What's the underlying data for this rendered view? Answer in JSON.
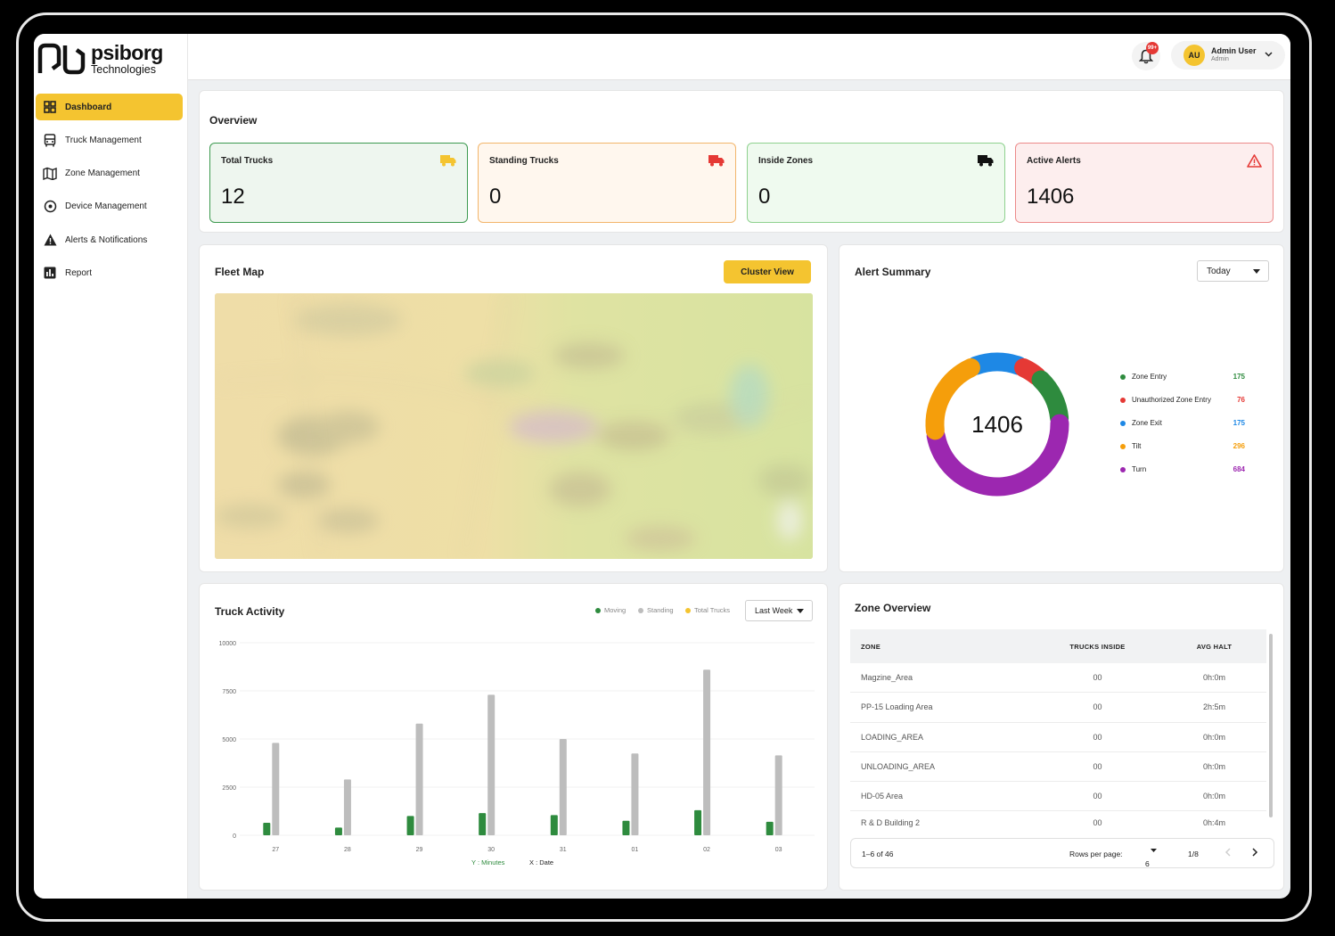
{
  "brand": {
    "name": "psiborg",
    "tagline": "Technologies"
  },
  "sidebar": {
    "items": [
      {
        "label": "Dashboard",
        "icon": "grid-icon",
        "active": true
      },
      {
        "label": "Truck Management",
        "icon": "truck-front-icon"
      },
      {
        "label": "Zone Management",
        "icon": "map-icon"
      },
      {
        "label": "Device Management",
        "icon": "target-icon"
      },
      {
        "label": "Alerts & Notifications",
        "icon": "warning-icon"
      },
      {
        "label": "Report",
        "icon": "bar-chart-icon"
      }
    ]
  },
  "topbar": {
    "notifications_badge": "99+",
    "user": {
      "initials": "AU",
      "name": "Admin User",
      "role": "Admin"
    }
  },
  "overview": {
    "title": "Overview",
    "stats": [
      {
        "label": "Total Trucks",
        "value": "12",
        "color": "#3d9a50",
        "bg": "#eef6ef",
        "icon_color": "#f4c430"
      },
      {
        "label": "Standing Trucks",
        "value": "0",
        "color": "#f2b56b",
        "bg": "#fff7ee",
        "icon_color": "#e53935"
      },
      {
        "label": "Inside Zones",
        "value": "0",
        "color": "#8fd18f",
        "bg": "#effaef",
        "icon_color": "#111111"
      },
      {
        "label": "Active Alerts",
        "value": "1406",
        "color": "#ec8a8a",
        "bg": "#fdeeee",
        "icon_color": "#e53935"
      }
    ]
  },
  "fleet_map": {
    "title": "Fleet Map",
    "button": "Cluster View"
  },
  "alert_summary": {
    "title": "Alert Summary",
    "filter": "Today",
    "total": "1406",
    "items": [
      {
        "label": "Zone Entry",
        "value": 175,
        "color": "#2e8b3e"
      },
      {
        "label": "Unauthorized Zone Entry",
        "value": 76,
        "color": "#e53935"
      },
      {
        "label": "Zone Exit",
        "value": 175,
        "color": "#1e88e5"
      },
      {
        "label": "Tilt",
        "value": 296,
        "color": "#f59e0b"
      },
      {
        "label": "Turn",
        "value": 684,
        "color": "#9c27b0"
      }
    ]
  },
  "truck_activity": {
    "title": "Truck Activity",
    "filter": "Last Week",
    "legend": [
      {
        "label": "Moving",
        "color": "#2e8b3e"
      },
      {
        "label": "Standing",
        "color": "#bdbdbd"
      },
      {
        "label": "Total Trucks",
        "color": "#f4c430"
      }
    ],
    "y_axis_label": "Y : Minutes",
    "x_axis_label": "X : Date"
  },
  "chart_data": {
    "type": "bar",
    "categories": [
      "27",
      "28",
      "29",
      "30",
      "31",
      "01",
      "02",
      "03"
    ],
    "series": [
      {
        "name": "Moving",
        "values": [
          650,
          400,
          1000,
          1150,
          1050,
          750,
          1300,
          700
        ],
        "color": "#2e8b3e"
      },
      {
        "name": "Standing",
        "values": [
          4800,
          2900,
          5800,
          7300,
          5000,
          4250,
          8600,
          4150
        ],
        "color": "#bdbdbd"
      }
    ],
    "yticks": [
      0,
      2500,
      5000,
      7500,
      10000
    ],
    "ylim": [
      0,
      10000
    ],
    "xlabel": "X : Date",
    "ylabel": "Y : Minutes",
    "legend_position": "top-right"
  },
  "zone_overview": {
    "title": "Zone Overview",
    "columns": [
      "ZONE",
      "TRUCKS INSIDE",
      "AVG HALT"
    ],
    "rows": [
      [
        "Magzine_Area",
        "00",
        "0h:0m"
      ],
      [
        "PP-15 Loading Area",
        "00",
        "2h:5m"
      ],
      [
        "LOADING_AREA",
        "00",
        "0h:0m"
      ],
      [
        "UNLOADING_AREA",
        "00",
        "0h:0m"
      ],
      [
        "HD-05 Area",
        "00",
        "0h:0m"
      ],
      [
        "R & D Building 2",
        "00",
        "0h:4m"
      ]
    ],
    "pagination": {
      "range": "1–6 of 46",
      "rows_per_page_label": "Rows per page:",
      "rows_per_page": "6",
      "page": "1/8"
    }
  }
}
